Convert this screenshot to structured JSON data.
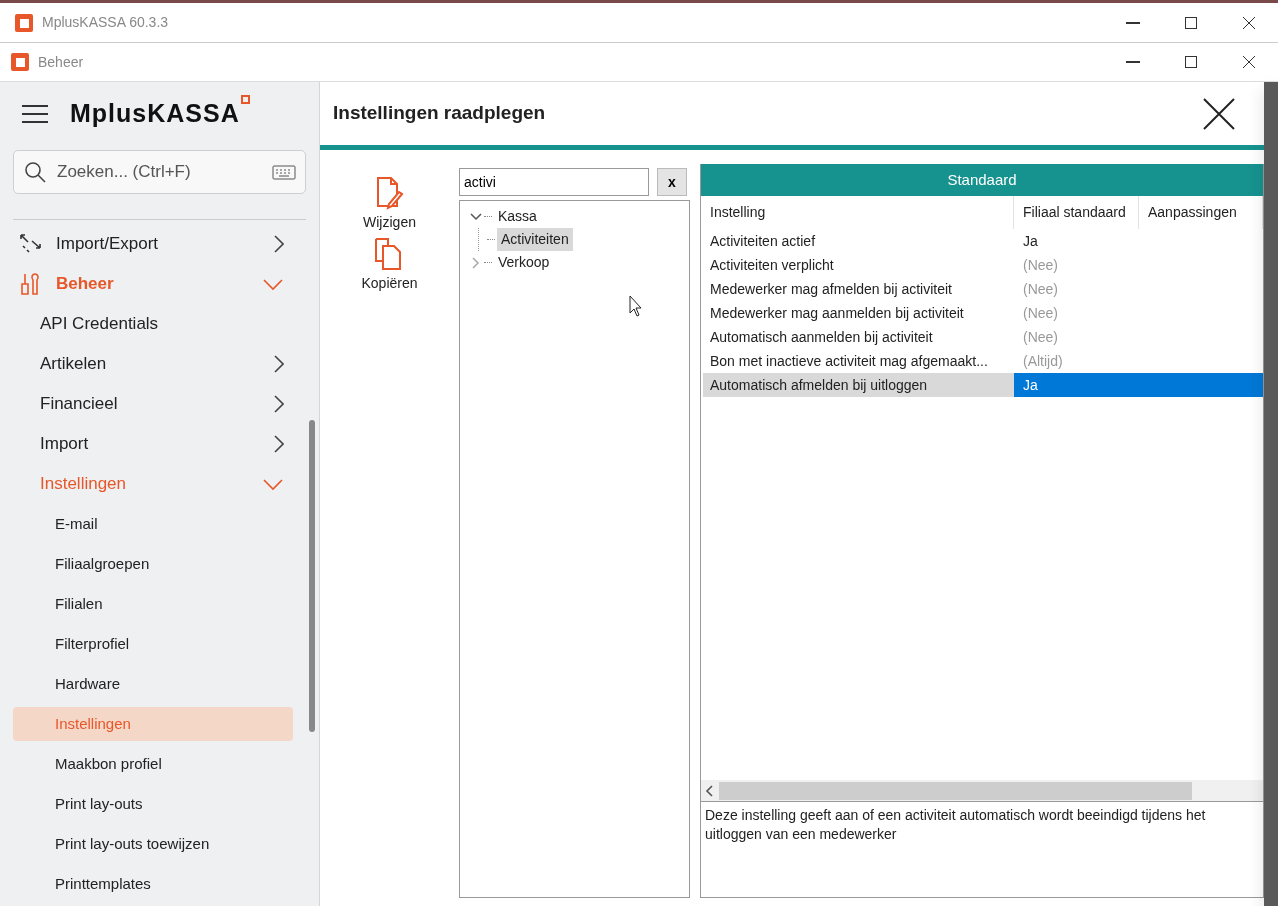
{
  "outer_window": {
    "title": "MplusKASSA 60.3.3"
  },
  "inner_window": {
    "title": "Beheer"
  },
  "sidebar": {
    "logo": "MplusKASSA",
    "search": {
      "placeholder": "Zoeken... (Ctrl+F)"
    },
    "items": [
      {
        "label": "Import/Export",
        "kind": "arrows",
        "expanded": false
      },
      {
        "label": "Beheer",
        "kind": "tools",
        "expanded": true,
        "children": [
          {
            "label": "API Credentials"
          },
          {
            "label": "Artikelen",
            "expanded": false
          },
          {
            "label": "Financieel",
            "expanded": false
          },
          {
            "label": "Import",
            "expanded": false
          },
          {
            "label": "Instellingen",
            "expanded": true,
            "children": [
              {
                "label": "E-mail",
                "selected": false
              },
              {
                "label": "Filiaalgroepen",
                "selected": false
              },
              {
                "label": "Filialen",
                "selected": false
              },
              {
                "label": "Filterprofiel",
                "selected": false
              },
              {
                "label": "Hardware",
                "selected": false
              },
              {
                "label": "Instellingen",
                "selected": true
              },
              {
                "label": "Maakbon profiel",
                "selected": false
              },
              {
                "label": "Print lay-outs",
                "selected": false
              },
              {
                "label": "Print lay-outs toewijzen",
                "selected": false
              },
              {
                "label": "Printtemplates",
                "selected": false
              }
            ]
          }
        ]
      }
    ]
  },
  "page": {
    "title": "Instellingen raadplegen"
  },
  "actions": [
    {
      "label": "Wijzigen",
      "kind": "edit"
    },
    {
      "label": "Kopiëren",
      "kind": "copy"
    }
  ],
  "filter": {
    "value": "activi",
    "clear_label": "x"
  },
  "tree": [
    {
      "label": "Kassa",
      "expanded": true,
      "selected": false,
      "children": [
        {
          "label": "Activiteiten",
          "selected": true
        }
      ]
    },
    {
      "label": "Verkoop",
      "expanded": false,
      "selected": false
    }
  ],
  "settings": {
    "group": "Standaard",
    "columns": [
      "Instelling",
      "Filiaal standaard",
      "Aanpassingen"
    ],
    "rows": [
      {
        "setting": "Activiteiten actief",
        "value": "Ja",
        "inherited": false,
        "selected": false
      },
      {
        "setting": "Activiteiten verplicht",
        "value": "(Nee)",
        "inherited": true,
        "selected": false
      },
      {
        "setting": "Medewerker mag afmelden bij activiteit",
        "value": "(Nee)",
        "inherited": true,
        "selected": false
      },
      {
        "setting": "Medewerker mag aanmelden bij activiteit",
        "value": "(Nee)",
        "inherited": true,
        "selected": false
      },
      {
        "setting": "Automatisch aanmelden bij activiteit",
        "value": "(Nee)",
        "inherited": true,
        "selected": false
      },
      {
        "setting": "Bon met inactieve activiteit mag afgemaakt...",
        "value": "(Altijd)",
        "inherited": true,
        "selected": false
      },
      {
        "setting": "Automatisch afmelden bij uitloggen",
        "value": "Ja",
        "inherited": false,
        "selected": true
      }
    ],
    "description": "Deze instelling geeft aan of een activiteit automatisch wordt beeindigd tijdens het uitloggen van een medewerker"
  }
}
